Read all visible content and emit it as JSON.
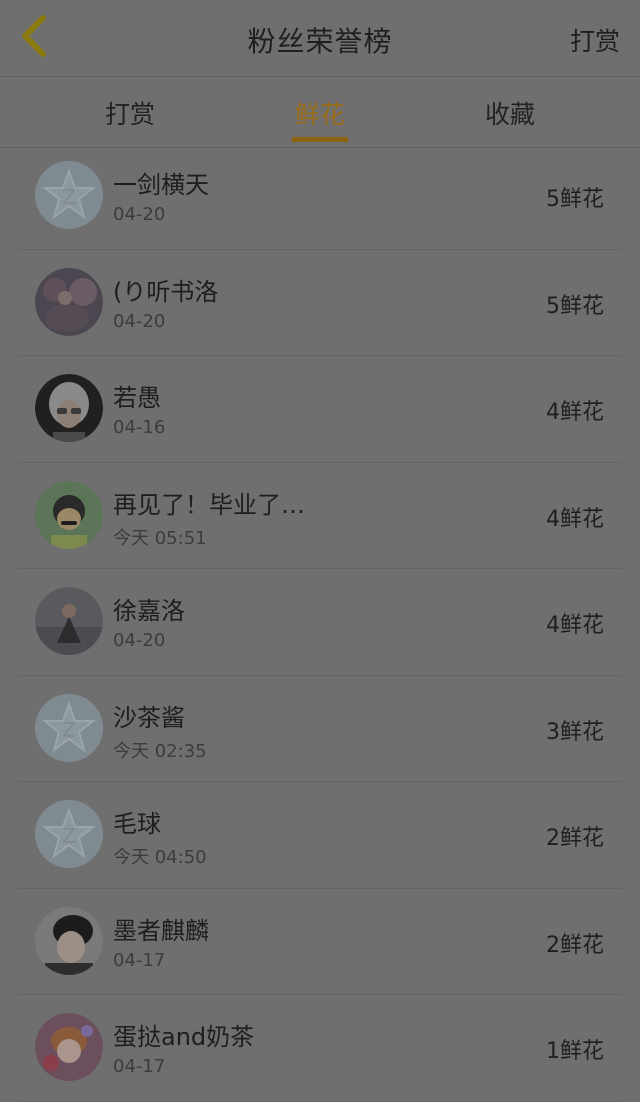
{
  "header": {
    "title": "粉丝荣誉榜",
    "action_label": "打赏"
  },
  "tabs": [
    {
      "label": "打赏",
      "active": false
    },
    {
      "label": "鲜花",
      "active": true
    },
    {
      "label": "收藏",
      "active": false
    }
  ],
  "accent_color": "#9a6c18",
  "list": [
    {
      "name": "一剑横天",
      "time": "04-20",
      "count": "5鲜花",
      "avatar": "default-star-avatar"
    },
    {
      "name": "(り听书洛",
      "time": "04-20",
      "count": "5鲜花",
      "avatar": "photo-avatar"
    },
    {
      "name": "若愚",
      "time": "04-16",
      "count": "4鲜花",
      "avatar": "photo-avatar"
    },
    {
      "name": "再见了！毕业了…",
      "time": "今天 05:51",
      "count": "4鲜花",
      "avatar": "photo-avatar"
    },
    {
      "name": "徐嘉洛",
      "time": "04-20",
      "count": "4鲜花",
      "avatar": "photo-avatar"
    },
    {
      "name": "沙茶酱",
      "time": "今天 02:35",
      "count": "3鲜花",
      "avatar": "default-star-avatar"
    },
    {
      "name": "毛球",
      "time": "今天 04:50",
      "count": "2鲜花",
      "avatar": "default-star-avatar"
    },
    {
      "name": "墨者麒麟",
      "time": "04-17",
      "count": "2鲜花",
      "avatar": "photo-avatar"
    },
    {
      "name": "蛋挞and奶茶",
      "time": "04-17",
      "count": "1鲜花",
      "avatar": "photo-avatar"
    }
  ]
}
